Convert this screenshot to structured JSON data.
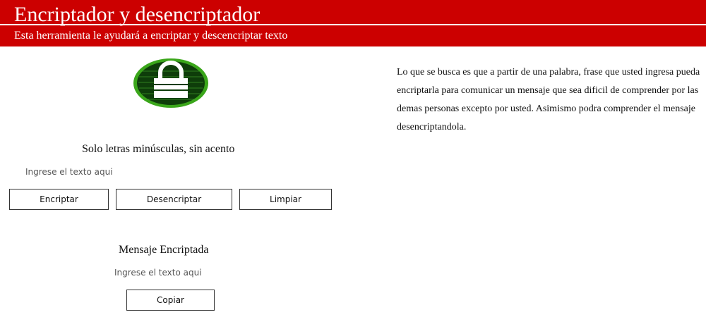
{
  "header": {
    "title": "Encriptador y desencriptador",
    "subtitle": "Esta herramienta le ayudará a encriptar y descencriptar texto",
    "bg_color": "#cc0000"
  },
  "logo": {
    "icon": "padlock-icon",
    "colors": {
      "ring": "#3aa61a",
      "fill": "#0e3d0a",
      "lock": "#ffffff"
    }
  },
  "description": "Lo que se busca es que a partir de una palabra, frase que usted ingresa pueda encriptarla para comunicar un mensaje que sea dificil de comprender por las demas personas excepto por usted. Asimismo podra comprender el mensaje desencriptandola.",
  "input_section": {
    "title": "Solo letras minúsculas, sin acento",
    "input_placeholder": "Ingrese el texto aqui",
    "input_value": ""
  },
  "buttons": {
    "encrypt": "Encriptar",
    "decrypt": "Desencriptar",
    "clear": "Limpiar"
  },
  "output_section": {
    "title": "Mensaje Encriptada",
    "output_placeholder": "Ingrese el texto aqui",
    "copy": "Copiar"
  }
}
